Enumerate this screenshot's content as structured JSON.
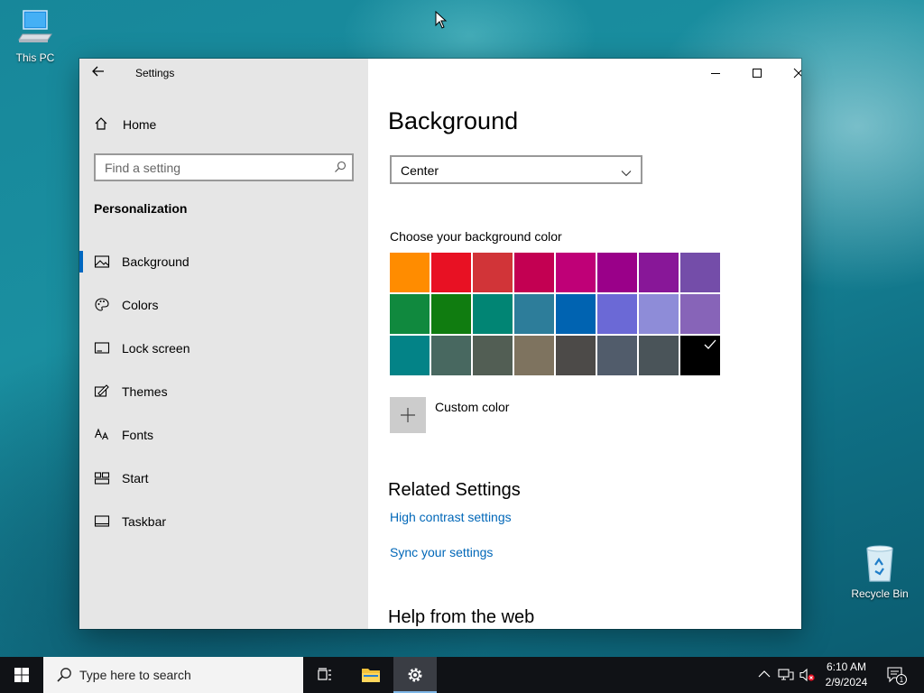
{
  "desktop": {
    "icons": [
      {
        "label": "This PC",
        "icon": "computer-icon"
      },
      {
        "label": "Recycle Bin",
        "icon": "recycle-bin-icon"
      }
    ]
  },
  "window": {
    "title": "Settings",
    "back_icon": "back-arrow-icon",
    "caption_icons": [
      "minimize-icon",
      "maximize-icon",
      "close-icon"
    ]
  },
  "sidebar": {
    "home_label": "Home",
    "search_placeholder": "Find a setting",
    "section_title": "Personalization",
    "items": [
      {
        "label": "Background",
        "icon": "picture-icon",
        "active": true
      },
      {
        "label": "Colors",
        "icon": "palette-icon",
        "active": false
      },
      {
        "label": "Lock screen",
        "icon": "lock-screen-icon",
        "active": false
      },
      {
        "label": "Themes",
        "icon": "themes-icon",
        "active": false
      },
      {
        "label": "Fonts",
        "icon": "fonts-icon",
        "active": false
      },
      {
        "label": "Start",
        "icon": "start-layout-icon",
        "active": false
      },
      {
        "label": "Taskbar",
        "icon": "taskbar-icon",
        "active": false
      }
    ]
  },
  "main": {
    "title": "Background",
    "dropdown_value": "Center",
    "color_section_label": "Choose your background color",
    "swatches": [
      "#FF8C00",
      "#E81123",
      "#D13438",
      "#C30052",
      "#BF0077",
      "#9A0089",
      "#881798",
      "#744DA9",
      "#10893E",
      "#107C10",
      "#018574",
      "#2D7D9A",
      "#0063B1",
      "#6B69D6",
      "#8E8CD8",
      "#8764B8",
      "#038387",
      "#486860",
      "#525E54",
      "#7E735F",
      "#4C4A48",
      "#515C6B",
      "#4A5459",
      "#000000"
    ],
    "selected_swatch_index": 23,
    "custom_color_label": "Custom color",
    "related_heading": "Related Settings",
    "links": [
      "High contrast settings",
      "Sync your settings"
    ],
    "help_heading": "Help from the web"
  },
  "taskbar": {
    "search_placeholder": "Type here to search",
    "time": "6:10 AM",
    "date": "2/9/2024",
    "notification_count": "1"
  }
}
